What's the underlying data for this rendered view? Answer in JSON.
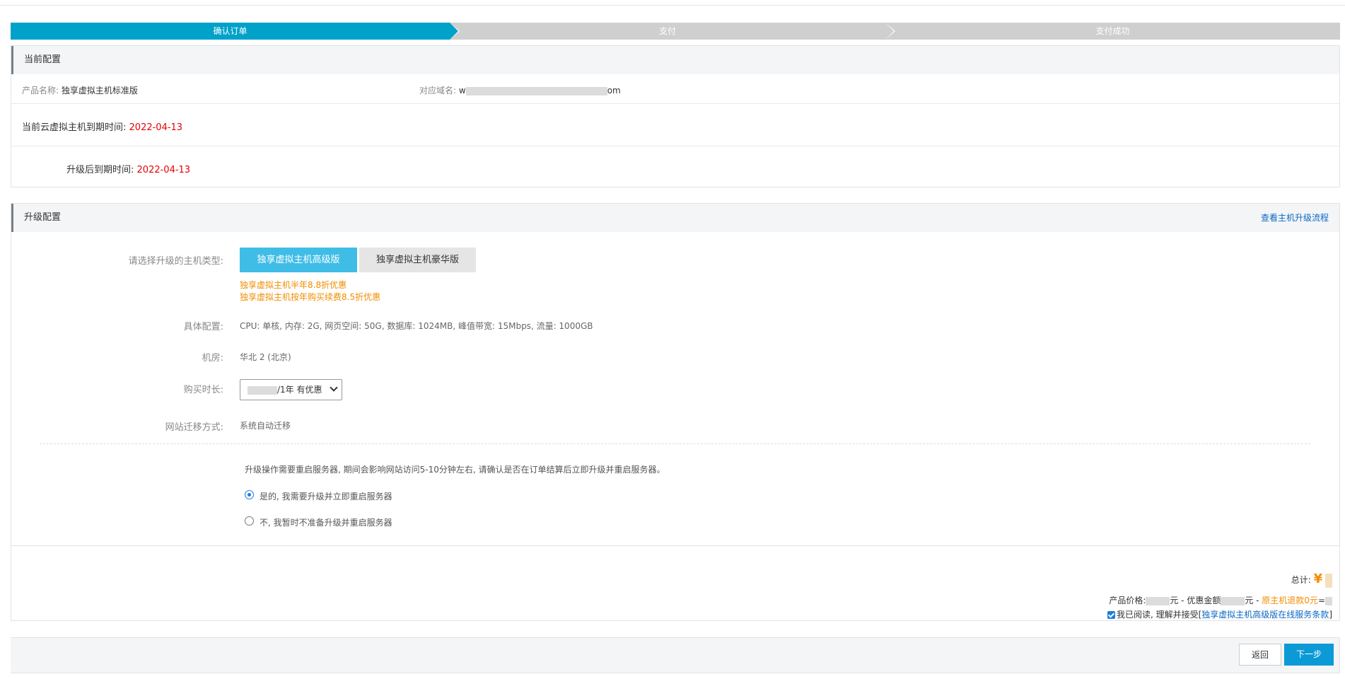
{
  "steps": {
    "step1": "确认订单",
    "step2": "支付",
    "step3": "支付成功"
  },
  "current": {
    "title": "当前配置",
    "product_label": "产品名称:",
    "product_value": "独享虚拟主机标准版",
    "domain_label": "对应域名:",
    "domain_prefix": "w",
    "domain_suffix": "om",
    "current_expire_label": "当前云虚拟主机到期时间:",
    "current_expire_value": "2022-04-13",
    "after_expire_label": "升级后到期时间:",
    "after_expire_value": "2022-04-13"
  },
  "upgrade": {
    "title": "升级配置",
    "flow_link": "查看主机升级流程",
    "type_label": "请选择升级的主机类型:",
    "type_active": "独享虚拟主机高级版",
    "type_other": "独享虚拟主机豪华版",
    "promo1": "独享虚拟主机半年8.8折优惠",
    "promo2": "独享虚拟主机按年购买续费8.5折优惠",
    "spec_label": "具体配置:",
    "spec_value": "CPU: 单核, 内存: 2G, 网页空间: 50G, 数据库: 1024MB, 峰值带宽: 15Mbps, 流量: 1000GB",
    "room_label": "机房:",
    "room_value": "华北 2 (北京)",
    "duration_label": "购买时长:",
    "duration_value": "/1年 有优惠",
    "migrate_label": "网站迁移方式:",
    "migrate_value": "系统自动迁移",
    "notice": "升级操作需要重启服务器, 期间会影响网站访问5-10分钟左右, 请确认是否在订单结算后立即升级并重启服务器。",
    "option_yes": "是的, 我需要升级并立即重启服务器",
    "option_no": "不, 我暂时不准备升级并重启服务器"
  },
  "total": {
    "total_label": "总计:",
    "yen": "¥",
    "price_label": "产品价格:",
    "price_unit": "元 - 优惠金额",
    "discount_unit": "元 - ",
    "refund": "原主机退款0元",
    "equals": "=",
    "agree_text": "我已阅读, 理解并接受[",
    "agree_link": "独享虚拟主机高级版在线服务条款",
    "agree_end": "]"
  },
  "footer": {
    "back": "返回",
    "next": "下一步"
  }
}
